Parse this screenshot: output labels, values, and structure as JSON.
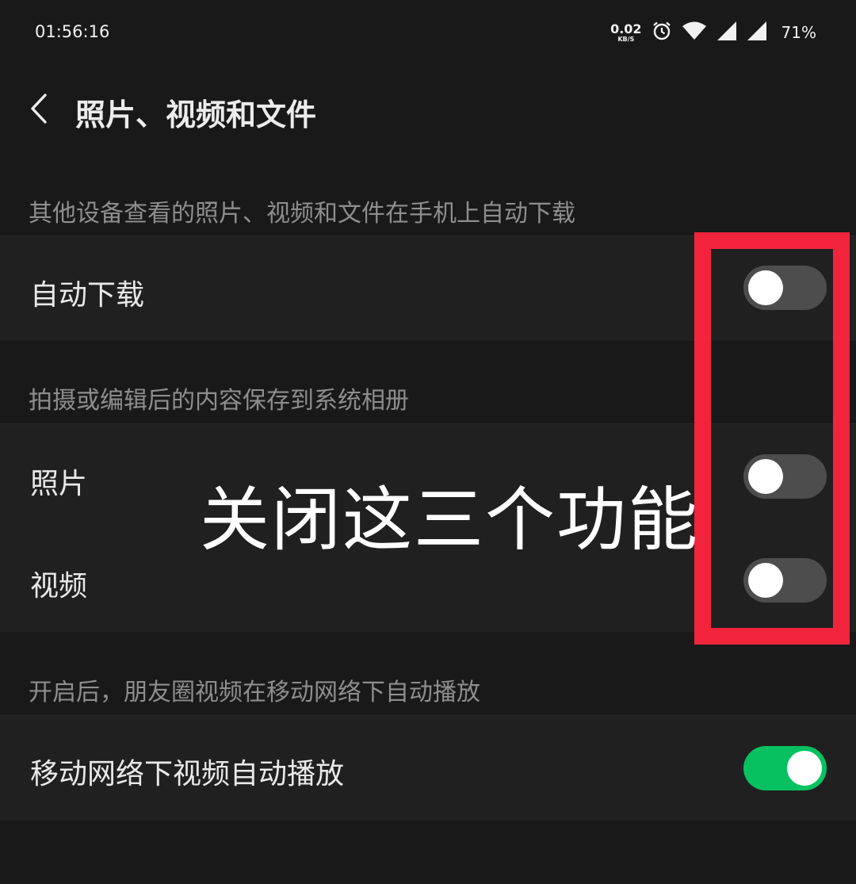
{
  "status_bar": {
    "time": "01:56:16",
    "net_speed_value": "0.02",
    "net_speed_unit": "KB/S",
    "icons": [
      "alarm-icon",
      "wifi-icon",
      "signal-icon",
      "signal-icon"
    ],
    "battery": "71%"
  },
  "header": {
    "back_icon": "chevron-left-icon",
    "title": "照片、视频和文件"
  },
  "sections": [
    {
      "caption": "其他设备查看的照片、视频和文件在手机上自动下载",
      "rows": [
        {
          "label": "自动下载",
          "enabled": false
        }
      ]
    },
    {
      "caption": "拍摄或编辑后的内容保存到系统相册",
      "rows": [
        {
          "label": "照片",
          "enabled": false
        },
        {
          "label": "视频",
          "enabled": false
        }
      ]
    },
    {
      "caption": "开启后，朋友圈视频在移动网络下自动播放",
      "rows": [
        {
          "label": "移动网络下视频自动播放",
          "enabled": true
        }
      ]
    }
  ],
  "annotation": {
    "text": "关闭这三个功能",
    "color": "#f2243c"
  },
  "colors": {
    "background": "#191919",
    "row_background": "#202020",
    "switch_on": "#07c160",
    "switch_off": "#4d4d4d"
  }
}
